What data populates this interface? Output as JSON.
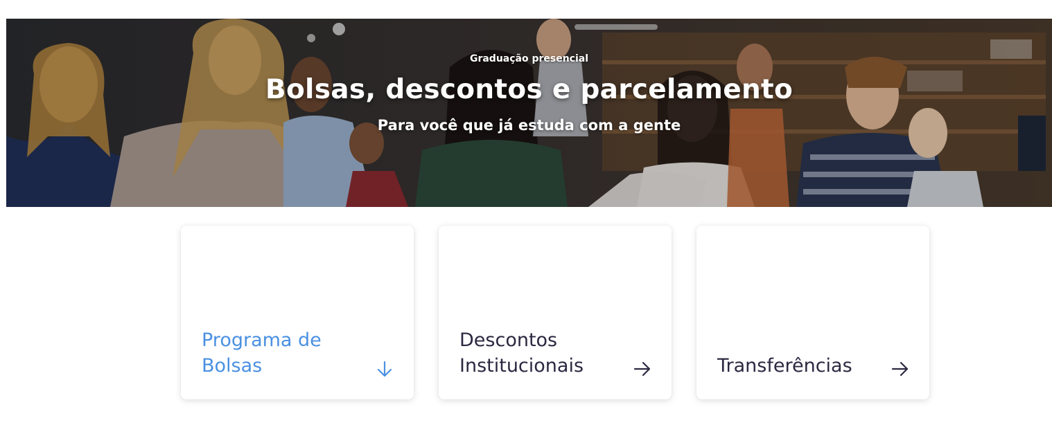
{
  "hero": {
    "eyebrow": "Graduação presencial",
    "title": "Bolsas, descontos e parcelamento",
    "subtitle": "Para você que já estuda com a gente"
  },
  "cards": [
    {
      "label": "Programa de\nBolsas",
      "icon": "arrow-down-icon",
      "active": true
    },
    {
      "label": "Descontos\nInstitucionais",
      "icon": "arrow-right-icon",
      "active": false
    },
    {
      "label": "Transferências",
      "icon": "arrow-right-icon",
      "active": false
    }
  ],
  "colors": {
    "active": "#4a90e2",
    "text": "#2b2840",
    "arrow": "#2b2840"
  }
}
